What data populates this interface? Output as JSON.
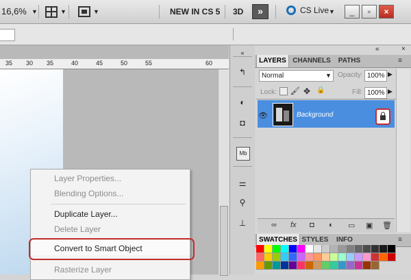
{
  "appbar": {
    "zoom": "16,6%",
    "new_in_cs5": "NEW IN CS 5",
    "three_d": "3D",
    "workspace_more": "»",
    "cs_live": "CS Live",
    "dropdown_glyph": "▼"
  },
  "ruler": {
    "ticks": [
      "35",
      "30",
      "35",
      "40",
      "45",
      "50",
      "55",
      "60"
    ]
  },
  "context_menu": {
    "items": [
      {
        "label": "Layer Properties...",
        "enabled": false
      },
      {
        "label": "Blending Options...",
        "enabled": false
      },
      {
        "label": "Duplicate Layer...",
        "enabled": true
      },
      {
        "label": "Delete Layer",
        "enabled": false
      },
      {
        "label": "Convert to Smart Object",
        "enabled": true,
        "highlighted": true
      },
      {
        "label": "Rasterize Layer",
        "enabled": false
      }
    ]
  },
  "layers_panel": {
    "tabs": [
      "LAYERS",
      "CHANNELS",
      "PATHS"
    ],
    "active_tab": "LAYERS",
    "blend_mode": "Normal",
    "opacity_label": "Opacity:",
    "opacity_value": "100%",
    "lock_label": "Lock:",
    "fill_label": "Fill:",
    "fill_value": "100%",
    "layer": {
      "name": "Background",
      "visible": true,
      "locked": true
    }
  },
  "swatches_panel": {
    "tabs": [
      "SWATCHES",
      "STYLES",
      "INFO"
    ],
    "active_tab": "SWATCHES",
    "colors": [
      "#ff0000",
      "#ffff00",
      "#00ff00",
      "#00ffff",
      "#0000ff",
      "#ff00ff",
      "#ffffff",
      "#e6e6e6",
      "#cccccc",
      "#b3b3b3",
      "#999999",
      "#808080",
      "#666666",
      "#4d4d4d",
      "#333333",
      "#1a1a1a",
      "#000000",
      "#ff6666",
      "#ffcc00",
      "#99cc00",
      "#33ccff",
      "#3366ff",
      "#cc66ff",
      "#ff9999",
      "#ff9966",
      "#ffcc99",
      "#ccff99",
      "#99ffcc",
      "#99ccff",
      "#cc99ff",
      "#ff99cc",
      "#cc3333",
      "#ff6600",
      "#cc0000",
      "#ff9900",
      "#669900",
      "#009999",
      "#003399",
      "#660099",
      "#ff3366",
      "#cc6600",
      "#cc9966",
      "#66cc66",
      "#33cc99",
      "#3399cc",
      "#9966cc",
      "#cc3399",
      "#993300",
      "#996633"
    ]
  },
  "icons": {
    "eye": "👁",
    "lock": "🔒",
    "brush": "🖌",
    "move": "✥",
    "link": "∞",
    "fx": "fx",
    "mask": "◘",
    "adjust": "◐",
    "folder": "▭",
    "new_layer": "▣",
    "trash": "🗑",
    "menu": "≡",
    "collapse": "«",
    "close": "×",
    "pin": "◢"
  },
  "window_controls": {
    "minimize": "_",
    "restore": "▫",
    "close": "×"
  },
  "colors": {
    "selection_blue": "#4a8ee0",
    "highlight_ring": "#c42c2c"
  }
}
